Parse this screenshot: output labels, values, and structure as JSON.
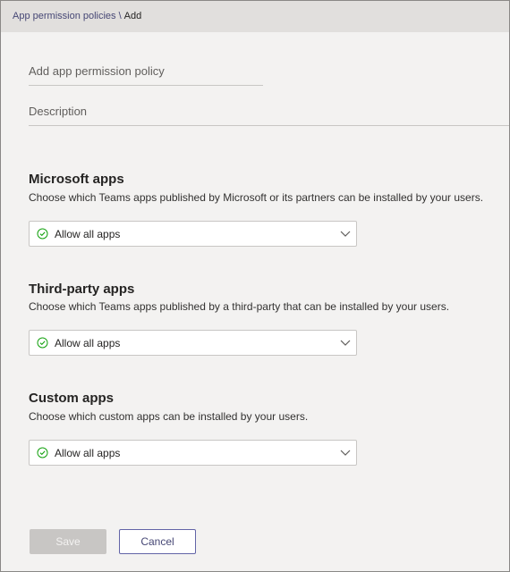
{
  "breadcrumb": {
    "parent": "App permission policies",
    "separator": "\\",
    "current": "Add"
  },
  "form": {
    "name_placeholder": "Add app permission policy",
    "description_placeholder": "Description"
  },
  "sections": {
    "microsoft": {
      "title": "Microsoft apps",
      "description": "Choose which Teams apps published by Microsoft or its partners can be installed by your users.",
      "selected": "Allow all apps"
    },
    "third_party": {
      "title": "Third-party apps",
      "description": "Choose which Teams apps published by a third-party that can be installed by your users.",
      "selected": "Allow all apps"
    },
    "custom": {
      "title": "Custom apps",
      "description": "Choose which custom apps can be installed by your users.",
      "selected": "Allow all apps"
    }
  },
  "actions": {
    "save_label": "Save",
    "cancel_label": "Cancel"
  },
  "colors": {
    "accent": "#6264a7",
    "check": "#13a10e",
    "disabled": "#c8c6c4"
  },
  "icons": {
    "selected_option": "check-circle-icon",
    "dropdown": "chevron-down-icon"
  }
}
